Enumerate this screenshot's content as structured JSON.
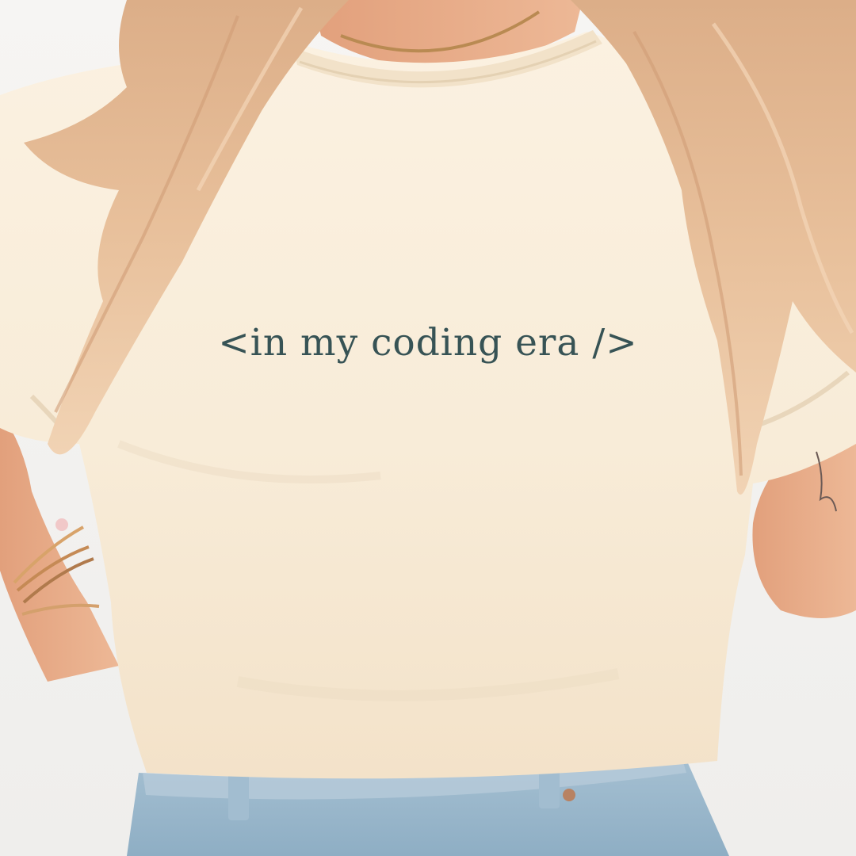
{
  "print": {
    "text": "<in my coding era />",
    "color": "#2d4b4e"
  },
  "palette": {
    "shirt": "#f8ecd9",
    "hair": "#e4b58e",
    "skin": "#e6a985",
    "denim": "#9cb8cc",
    "background": "#f4f3f1"
  }
}
